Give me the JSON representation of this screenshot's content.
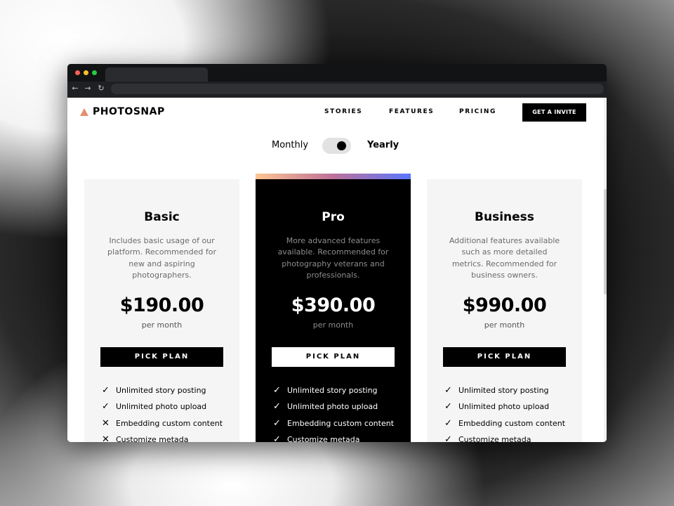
{
  "brand": {
    "name": "PHOTOSNAP"
  },
  "nav": {
    "links": [
      "STORIES",
      "FEATURES",
      "PRICING"
    ],
    "cta": "GET A INVITE"
  },
  "billing_toggle": {
    "left_label": "Monthly",
    "right_label": "Yearly",
    "selected": "Yearly"
  },
  "plans": [
    {
      "title": "Basic",
      "description": "Includes basic usage of our platform. Recommended for new and aspiring photographers.",
      "price": "$190.00",
      "period": "per month",
      "button": "PICK PLAN",
      "features": [
        {
          "label": "Unlimited story posting",
          "included": true
        },
        {
          "label": "Unlimited photo upload",
          "included": true
        },
        {
          "label": "Embedding custom content",
          "included": false
        },
        {
          "label": "Customize metada",
          "included": false
        }
      ]
    },
    {
      "title": "Pro",
      "description": "More advanced features available. Recommended for photography veterans and professionals.",
      "price": "$390.00",
      "period": "per month",
      "button": "PICK PLAN",
      "features": [
        {
          "label": "Unlimited story posting",
          "included": true
        },
        {
          "label": "Unlimited photo upload",
          "included": true
        },
        {
          "label": "Embedding custom content",
          "included": true
        },
        {
          "label": "Customize metada",
          "included": true
        }
      ]
    },
    {
      "title": "Business",
      "description": "Additional features available such as more detailed metrics. Recommended for business owners.",
      "price": "$990.00",
      "period": "per month",
      "button": "PICK PLAN",
      "features": [
        {
          "label": "Unlimited story posting",
          "included": true
        },
        {
          "label": "Unlimited photo upload",
          "included": true
        },
        {
          "label": "Embedding custom content",
          "included": true
        },
        {
          "label": "Customize metada",
          "included": true
        }
      ]
    }
  ],
  "icons": {
    "check": "check-icon",
    "cross": "cross-icon",
    "logo": "logo-triangle-icon"
  },
  "colors": {
    "accent_gradient": [
      "#ffc593",
      "#bc7198",
      "#5a77ff"
    ],
    "dark": "#000000",
    "card_light": "#f5f5f5"
  }
}
